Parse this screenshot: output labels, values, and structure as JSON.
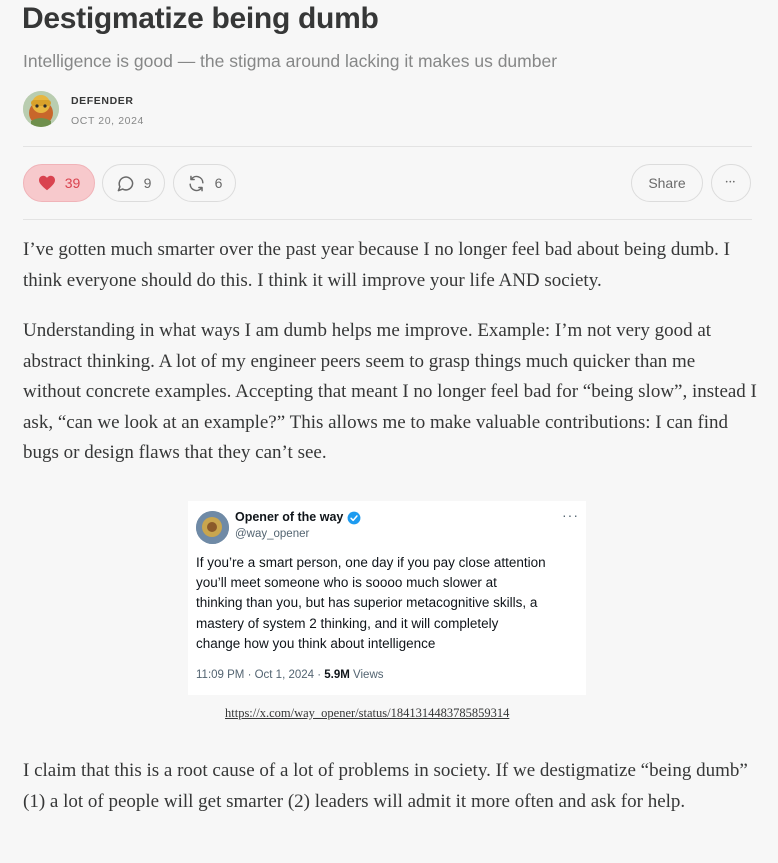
{
  "post": {
    "title": "Destigmatize being dumb",
    "subtitle": "Intelligence is good — the stigma around lacking it makes us dumber",
    "author": "DEFENDER",
    "date": "OCT 20, 2024"
  },
  "actions": {
    "likes": "39",
    "comments": "9",
    "restacks": "6",
    "share_label": "Share",
    "more_label": "•••"
  },
  "paragraphs": [
    "I’ve gotten much smarter over the past year because I no longer feel bad about being dumb. I think everyone should do this. I think it will improve your life AND society.",
    "Understanding in what ways I am dumb helps me improve. Example: I’m not very good at abstract thinking. A lot of my engineer peers seem to grasp things much quicker than me without concrete examples. Accepting that meant I no longer feel bad for “being slow”, instead I ask, “can we look at an example?” This allows me to make valuable contributions: I can find bugs or design flaws that they can’t see.",
    "I claim that this is a root cause of a lot of problems in society. If we destigmatize “being dumb” (1) a lot of people will get smarter (2) leaders will admit it more often and ask for help."
  ],
  "tweet": {
    "name": "Opener of the way",
    "handle": "@way_opener",
    "more": "···",
    "lines": [
      "If you’re a smart person, one day if you pay close attention",
      "you’ll meet someone who is soooo much slower at",
      "thinking than you, but has superior metacognitive skills, a",
      "mastery of system 2 thinking, and it will completely",
      "change how you think about intelligence"
    ],
    "timestamp": "11:09 PM · Oct 1, 2024 · ",
    "views_count": "5.9M",
    "views_label": " Views"
  },
  "tweet_link": "https://x.com/way_opener/status/1841314483785859314",
  "colors": {
    "accent_like": "#d9434f",
    "verified": "#1d9bf0"
  },
  "icons": {
    "like": "heart-icon",
    "comment": "comment-bubble-icon",
    "restack": "restack-icon",
    "more": "more-dots-icon",
    "verified": "verified-badge-icon"
  }
}
